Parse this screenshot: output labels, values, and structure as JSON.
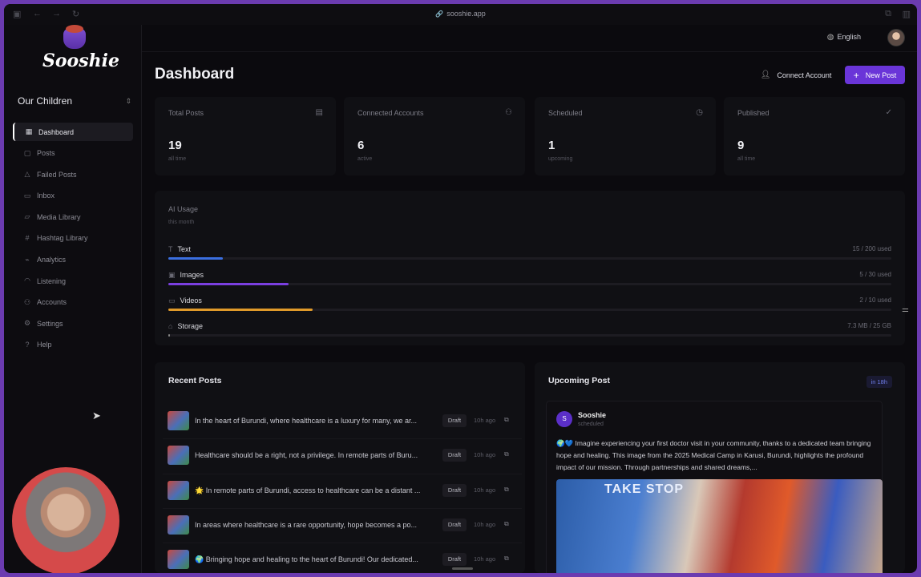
{
  "browser": {
    "url": "sooshie.app"
  },
  "brand": {
    "name": "Sooshie",
    "accent": "#6a35d8"
  },
  "org": {
    "name": "Our Children"
  },
  "nav": [
    {
      "label": "Dashboard",
      "icon": "grid-icon",
      "active": true
    },
    {
      "label": "Posts",
      "icon": "file-icon"
    },
    {
      "label": "Failed Posts",
      "icon": "warning-icon"
    },
    {
      "label": "Inbox",
      "icon": "inbox-icon"
    },
    {
      "label": "Media Library",
      "icon": "folder-icon"
    },
    {
      "label": "Hashtag Library",
      "icon": "hash-icon"
    },
    {
      "label": "Analytics",
      "icon": "chart-icon"
    },
    {
      "label": "Listening",
      "icon": "headphones-icon"
    },
    {
      "label": "Accounts",
      "icon": "users-icon"
    },
    {
      "label": "Settings",
      "icon": "gear-icon"
    },
    {
      "label": "Help",
      "icon": "help-icon"
    }
  ],
  "header": {
    "language": "English"
  },
  "page": {
    "title": "Dashboard",
    "connect_label": "Connect Account",
    "new_post_label": "New Post"
  },
  "stats": [
    {
      "title": "Total Posts",
      "value": "19",
      "sub": "all time",
      "icon": "document-icon"
    },
    {
      "title": "Connected Accounts",
      "value": "6",
      "sub": "active",
      "icon": "users-icon"
    },
    {
      "title": "Scheduled",
      "value": "1",
      "sub": "upcoming",
      "icon": "clock-icon"
    },
    {
      "title": "Published",
      "value": "9",
      "sub": "all time",
      "icon": "check-circle-icon"
    }
  ],
  "ai_usage": {
    "title": "AI Usage",
    "period": "this month",
    "items": [
      {
        "label": "Text",
        "value": "15 / 200 used",
        "fraction": 0.075,
        "color": "#3b6fe0"
      },
      {
        "label": "Images",
        "value": "5 / 30 used",
        "fraction": 0.1667,
        "color": "#7b3fe0"
      },
      {
        "label": "Videos",
        "value": "2 / 10 used",
        "fraction": 0.2,
        "color": "#e09a2a"
      },
      {
        "label": "Storage",
        "value": "7.3 MB / 25 GB",
        "fraction": 0.0003,
        "color": "#888888"
      }
    ]
  },
  "recent_posts": {
    "title": "Recent Posts",
    "items": [
      {
        "text": "In the heart of Burundi, where healthcare is a luxury for many, we ar...",
        "status": "Draft",
        "time": "10h ago"
      },
      {
        "text": "Healthcare should be a right, not a privilege. In remote parts of Buru...",
        "status": "Draft",
        "time": "10h ago"
      },
      {
        "text": "🌟 In remote parts of Burundi, access to healthcare can be a distant ...",
        "status": "Draft",
        "time": "10h ago"
      },
      {
        "text": "In areas where healthcare is a rare opportunity, hope becomes a po...",
        "status": "Draft",
        "time": "10h ago"
      },
      {
        "text": "🌍 Bringing hope and healing to the heart of Burundi! Our dedicated...",
        "status": "Draft",
        "time": "10h ago"
      }
    ]
  },
  "upcoming": {
    "title": "Upcoming Post",
    "due": "in 18h",
    "author": "Sooshie",
    "author_initial": "S",
    "state": "scheduled",
    "text": "🌍💙 Imagine experiencing your first doctor visit in your community, thanks to a dedicated team bringing hope and healing. This image from the 2025 Medical Camp in Karusi, Burundi, highlights the profound impact of our mission. Through partnerships and shared dreams,...",
    "image_text": "TAKE STOP"
  }
}
